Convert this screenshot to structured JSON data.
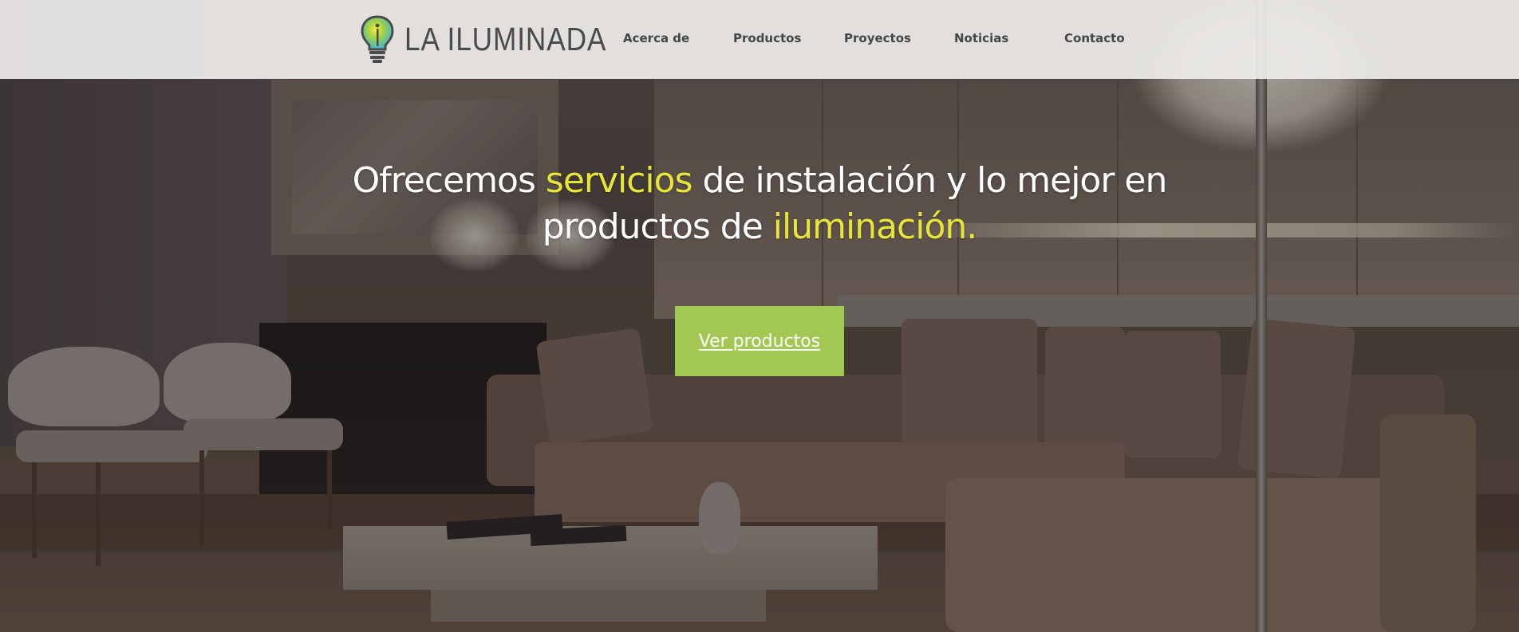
{
  "brand": {
    "name": "LA ILUMINADA",
    "colors": {
      "accent_yellow": "#e8e536",
      "cta_green": "#a2c853",
      "header_bg": "#eeecea",
      "nav_text": "#454545"
    },
    "logo_icon": "lightbulb-icon"
  },
  "nav": {
    "items": [
      {
        "label": "Acerca de"
      },
      {
        "label": "Productos"
      },
      {
        "label": "Proyectos"
      },
      {
        "label": "Noticias"
      },
      {
        "label": "Contacto"
      }
    ]
  },
  "hero": {
    "headline": {
      "part1": "Ofrecemos ",
      "accent1": "servicios",
      "part2": " de instalación y lo mejor en productos de ",
      "accent2": "iluminación."
    },
    "cta_label": "Ver productos",
    "background": "living-room-photo"
  }
}
